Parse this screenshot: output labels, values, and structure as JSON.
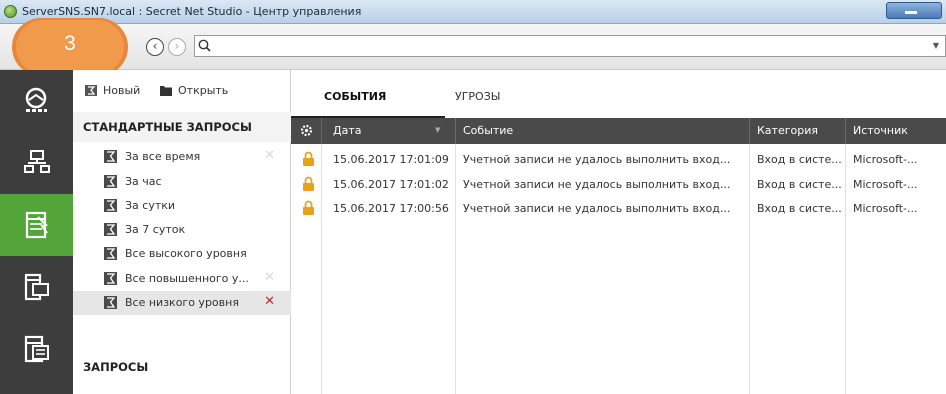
{
  "window": {
    "title": "ServerSNS.SN7.local : Secret Net Studio - Центр управления"
  },
  "navbar": {
    "logo_number": "3",
    "search_value": "",
    "search_placeholder": ""
  },
  "colors": {
    "accent_orange": "#f19a4c",
    "sidebar_dark": "#3d3d3d",
    "sidebar_active": "#53a53a",
    "grid_header": "#4a4a4a",
    "lock_icon": "#e8a21a",
    "remove_active": "#d9232b"
  },
  "iconbar": {
    "items": [
      {
        "icon": "dashboard-icon"
      },
      {
        "icon": "network-icon"
      },
      {
        "icon": "journal-icon"
      },
      {
        "icon": "computer-policy-icon"
      },
      {
        "icon": "server-icon"
      }
    ],
    "active_index": 2
  },
  "query_panel": {
    "toolbar": {
      "new_label": "Новый",
      "open_label": "Открыть"
    },
    "standard_section_title": "СТАНДАРТНЫЕ ЗАПРОСЫ",
    "standard_items": [
      {
        "label": "За все время",
        "removable": true
      },
      {
        "label": "За час",
        "removable": false
      },
      {
        "label": "За сутки",
        "removable": false
      },
      {
        "label": "За 7 суток",
        "removable": false
      },
      {
        "label": "Все высокого уровня",
        "removable": false
      },
      {
        "label": "Все повышенного у...",
        "removable": true
      },
      {
        "label": "Все низкого уровня",
        "removable": true,
        "selected": true
      }
    ],
    "queries_section_title": "ЗАПРОСЫ"
  },
  "main": {
    "tabs": [
      {
        "label": "СОБЫТИЯ",
        "active": true
      },
      {
        "label": "УГРОЗЫ",
        "active": false
      }
    ],
    "columns": [
      "Дата",
      "Событие",
      "Категория",
      "Источник"
    ],
    "rows": [
      {
        "date": "15.06.2017 17:01:09",
        "event": "Учетной записи не удалось выполнить вход...",
        "category": "Вход в систе...",
        "source": "Microsoft-..."
      },
      {
        "date": "15.06.2017 17:01:02",
        "event": "Учетной записи не удалось выполнить вход...",
        "category": "Вход в систе...",
        "source": "Microsoft-..."
      },
      {
        "date": "15.06.2017 17:00:56",
        "event": "Учетной записи не удалось выполнить вход...",
        "category": "Вход в систе...",
        "source": "Microsoft-..."
      }
    ]
  }
}
